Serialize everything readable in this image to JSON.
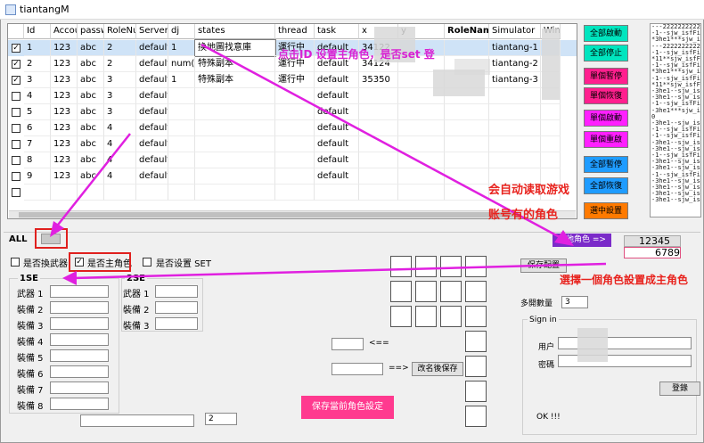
{
  "window": {
    "title": "tiantangM"
  },
  "grid": {
    "columns": [
      "",
      "Id",
      "Accou",
      "passw",
      "RoleNu",
      "Server",
      "dj",
      "states",
      "thread",
      "task",
      "x",
      "y",
      "RoleName",
      "Simulator",
      "Wind"
    ],
    "rows": [
      {
        "checked": true,
        "id": "1",
        "account": "123",
        "password": "abc",
        "role_num": "2",
        "server": "default",
        "dj": "1",
        "states": "換地圖找意庫",
        "thread": "運行中",
        "task": "default",
        "x": "34122",
        "simulator": "tiantang-1"
      },
      {
        "checked": true,
        "id": "2",
        "account": "123",
        "password": "abc",
        "role_num": "2",
        "server": "default",
        "dj": "num(6",
        "states": "特殊副本",
        "thread": "運行中",
        "task": "default",
        "x": "34124",
        "simulator": "tiantang-2"
      },
      {
        "checked": true,
        "id": "3",
        "account": "123",
        "password": "abc",
        "role_num": "3",
        "server": "default",
        "dj": "1",
        "states": "特殊副本",
        "thread": "運行中",
        "task": "default",
        "x": "35350",
        "simulator": "tiantang-3"
      },
      {
        "checked": false,
        "id": "4",
        "account": "123",
        "password": "abc",
        "role_num": "3",
        "server": "default",
        "dj": "",
        "states": "",
        "thread": "",
        "task": "default",
        "x": "",
        "simulator": ""
      },
      {
        "checked": false,
        "id": "5",
        "account": "123",
        "password": "abc",
        "role_num": "3",
        "server": "default",
        "dj": "",
        "states": "",
        "thread": "",
        "task": "default",
        "x": "",
        "simulator": ""
      },
      {
        "checked": false,
        "id": "6",
        "account": "123",
        "password": "abc",
        "role_num": "4",
        "server": "default",
        "dj": "",
        "states": "",
        "thread": "",
        "task": "default",
        "x": "",
        "simulator": ""
      },
      {
        "checked": false,
        "id": "7",
        "account": "123",
        "password": "abc",
        "role_num": "4",
        "server": "default",
        "dj": "",
        "states": "",
        "thread": "",
        "task": "default",
        "x": "",
        "simulator": ""
      },
      {
        "checked": false,
        "id": "8",
        "account": "123",
        "password": "abc",
        "role_num": "4",
        "server": "default",
        "dj": "",
        "states": "",
        "thread": "",
        "task": "default",
        "x": "",
        "simulator": ""
      },
      {
        "checked": false,
        "id": "9",
        "account": "123",
        "password": "abc",
        "role_num": "4",
        "server": "default",
        "dj": "",
        "states": "",
        "thread": "",
        "task": "default",
        "x": "",
        "simulator": ""
      },
      {
        "checked": false,
        "id": "",
        "account": "",
        "password": "",
        "role_num": "",
        "server": "",
        "dj": "",
        "states": "",
        "thread": "",
        "task": "",
        "x": "",
        "simulator": ""
      }
    ]
  },
  "side_buttons": [
    {
      "label": "全部啟動",
      "color": "#00e5bf"
    },
    {
      "label": "全部停止",
      "color": "#00e5bf"
    },
    {
      "label": "單個暫停",
      "color": "#ff1f8e"
    },
    {
      "label": "單個恢復",
      "color": "#ff1f8e"
    },
    {
      "label": "單個啟動",
      "color": "#ff1fff"
    },
    {
      "label": "單個重啟",
      "color": "#ff1fff"
    },
    {
      "label": "全部暫停",
      "color": "#1f9cff"
    },
    {
      "label": "全部恢復",
      "color": "#1f9cff"
    },
    {
      "label": "選中設置",
      "color": "#ff7a00"
    }
  ],
  "log_lines": [
    "---2222222222",
    "-1--sjw_isfFinish",
    "*3he1***sjw_isf",
    "---2222222222",
    "-1--sjw_isfFinish",
    "*11**sjw_isfFinish",
    "-1--sjw_isfFinish",
    "*3he1***sjw_isf",
    "-1--sjw_isfFinish",
    "*11**sjw_isfFinish",
    "-3he1--sjw_isfFu",
    "-3he1--sjw_isfFu",
    "-1--sjw_isfFinish",
    "-3he1***sjw_isf",
    "0",
    "-3he1--sjw_isfFu",
    "-1--sjw_isfFinish",
    "-1--sjw_isfFinish",
    "-3he1--sjw_isfFu",
    "-3he1--sjw_isfFu",
    "-1--sjw_isfFinish",
    "-3he1--sjw_isfFu",
    "-3he1--sjw_isfFu",
    "-1--sjw_isfFinish",
    "-3he1--sjw_isfFu",
    "-3he1--sjw_isfFu",
    "-3he1--sjw_isfFu",
    "-3he1--sjw_isfFu"
  ],
  "bottom": {
    "all_label": "ALL",
    "swap_weapon_label": "是否換武器",
    "is_main_role_label": "是否主角色",
    "is_set_label": "是否设置 SET",
    "set1_label": "1SE",
    "set2_label": "2SE",
    "weapon_label": "武器 1",
    "set1_equips": [
      "裝備 2",
      "裝備 3",
      "裝備 4",
      "裝備 5",
      "裝備 6",
      "裝備 7",
      "裝備 8"
    ],
    "set2_labels": [
      "武器 1",
      "裝備 2",
      "裝備 3"
    ],
    "arrow_left": "<==",
    "arrow_right": "==>",
    "rename_save_button": "改名後保存",
    "save_role_button": "保存當前角色設定",
    "field_value": "2",
    "other_role_button": "其他角色 =>",
    "other_role_value1": "12345",
    "other_role_value2": "6789",
    "save_config_button": "保存配置",
    "multi_open_label": "多開數量",
    "multi_open_value": "3",
    "sign_in_label": "Sign in",
    "user_label": "用户",
    "password_label": "密碼",
    "login_button": "登錄",
    "status_text": "OK !!!"
  },
  "annotations": {
    "click_id": "点击ID 设置主角色，是否set 登",
    "auto_read_1": "会自动读取游戏",
    "auto_read_2": "账号有的角色",
    "choose_role": "選擇一個角色設置成主角色"
  },
  "colors": {
    "magenta_arrow": "#e020e0",
    "red_highlight": "#e0201e",
    "selected_row": "#cfe3f7",
    "save_button": "#ff3a8f"
  }
}
